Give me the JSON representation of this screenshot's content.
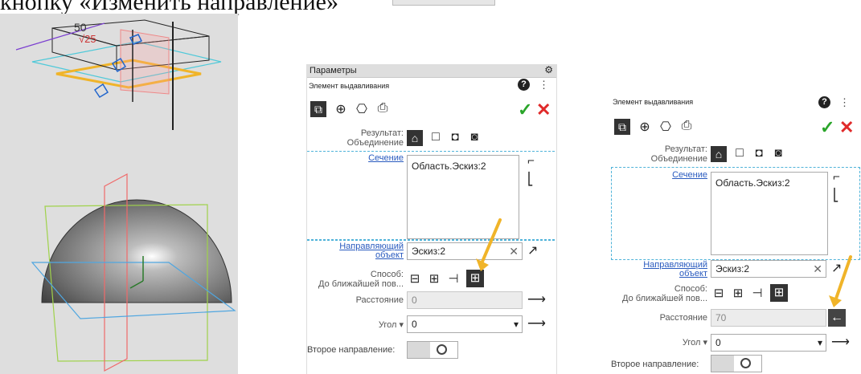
{
  "heading": {
    "text": "кнопку «Изменить направление»"
  },
  "viewport": {
    "dimensions": [
      "50",
      "√25"
    ]
  },
  "panel1": {
    "header": "Параметры",
    "subtitle": "Элемент выдавливания",
    "result_label": "Результат:",
    "result_value": "Объединение",
    "section_link": "Сечение",
    "section_value": "Область.Эскиз:2",
    "direction_link_line1": "Направляющий",
    "direction_link_line2": "объект",
    "direction_value": "Эскиз:2",
    "method_label": "Способ:",
    "method_value": "До ближайшей пов...",
    "distance_label": "Расстояние",
    "distance_value": "0",
    "angle_label": "Угол",
    "angle_value": "0",
    "second_direction_label": "Второе направление:",
    "confirm_glyph": "✓",
    "cancel_glyph": "✕",
    "help_glyph": "?"
  },
  "panel2": {
    "subtitle": "Элемент выдавливания",
    "result_label": "Результат:",
    "result_value": "Объединение",
    "section_link": "Сечение",
    "section_value": "Область.Эскиз:2",
    "direction_link_line1": "Направляющий",
    "direction_link_line2": "объект",
    "direction_value": "Эскиз:2",
    "method_label": "Способ:",
    "method_value": "До ближайшей пов...",
    "distance_label": "Расстояние",
    "distance_value": "70",
    "angle_label": "Угол",
    "angle_value": "0",
    "second_direction_label": "Второе направление:",
    "confirm_glyph": "✓",
    "cancel_glyph": "✕",
    "help_glyph": "?"
  },
  "colors": {
    "accent_yellow": "#f0b429",
    "link_blue": "#2a5bbf",
    "dash_cyan": "#4fb3d9",
    "check_green": "#2aa52a",
    "cancel_red": "#e02a2a"
  }
}
